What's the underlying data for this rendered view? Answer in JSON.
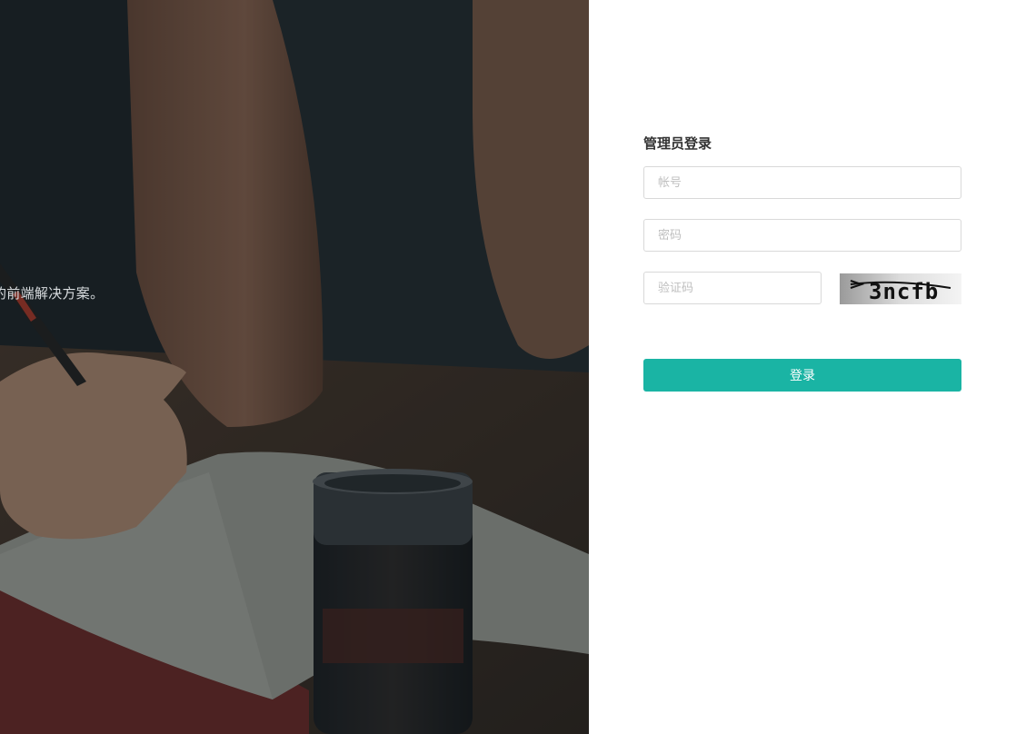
{
  "hero": {
    "tagline": "的前端解决方案。"
  },
  "login": {
    "title": "管理员登录",
    "account_placeholder": "帐号",
    "password_placeholder": "密码",
    "captcha_placeholder": "验证码",
    "captcha_text": "3ncfb",
    "submit_label": "登录"
  },
  "colors": {
    "accent": "#1ab4a4",
    "hero_overlay": "#1f272c",
    "input_border": "#d9d9d9"
  }
}
